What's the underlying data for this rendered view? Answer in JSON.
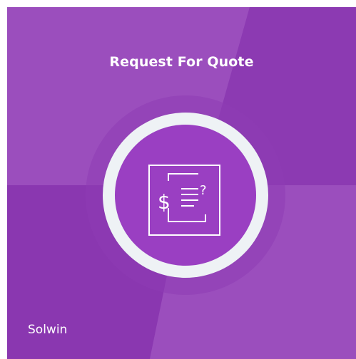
{
  "card": {
    "title": "Request For Quote",
    "brand": "Solwin",
    "icon": "quote-document-dollar-question-icon"
  },
  "colors": {
    "base": "#9241b8",
    "panel_light": "#9b4ebd",
    "panel_dark": "#8a37b0",
    "ring": "#eef2f5",
    "inner": "#9a3fc2",
    "halo": "#8e3db4",
    "icon_stroke": "#ffffff"
  }
}
